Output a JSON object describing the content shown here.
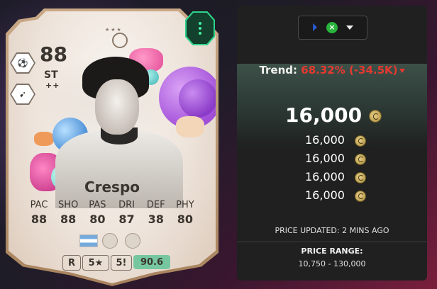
{
  "card": {
    "rating": "88",
    "position": "ST",
    "playstyle": "++",
    "name": "Crespo",
    "stats": [
      {
        "label": "PAC",
        "value": "88"
      },
      {
        "label": "SHO",
        "value": "88"
      },
      {
        "label": "PAS",
        "value": "80"
      },
      {
        "label": "DRI",
        "value": "87"
      },
      {
        "label": "DEF",
        "value": "38"
      },
      {
        "label": "PHY",
        "value": "80"
      }
    ],
    "work_rate": "R",
    "weak_foot": "5★",
    "skill_moves": "5!",
    "score": "90.6",
    "nationality_flag_colors": [
      "#75aadb",
      "#ffffff"
    ]
  },
  "panel": {
    "platform_icons": [
      "playstation-icon",
      "xbox-icon"
    ],
    "trend_label": "Trend:",
    "trend_value": "68.32% (-34.5K)",
    "main_price": "16,000",
    "prices": [
      "16,000",
      "16,000",
      "16,000",
      "16,000"
    ],
    "updated": "PRICE UPDATED: 2 MINS AGO",
    "range_label": "PRICE RANGE:",
    "range_value": "10,750 - 130,000"
  },
  "colors": {
    "trend_negative": "#e5392f",
    "evo_green": "#2dd48a",
    "score_green": "#76c7a0"
  }
}
